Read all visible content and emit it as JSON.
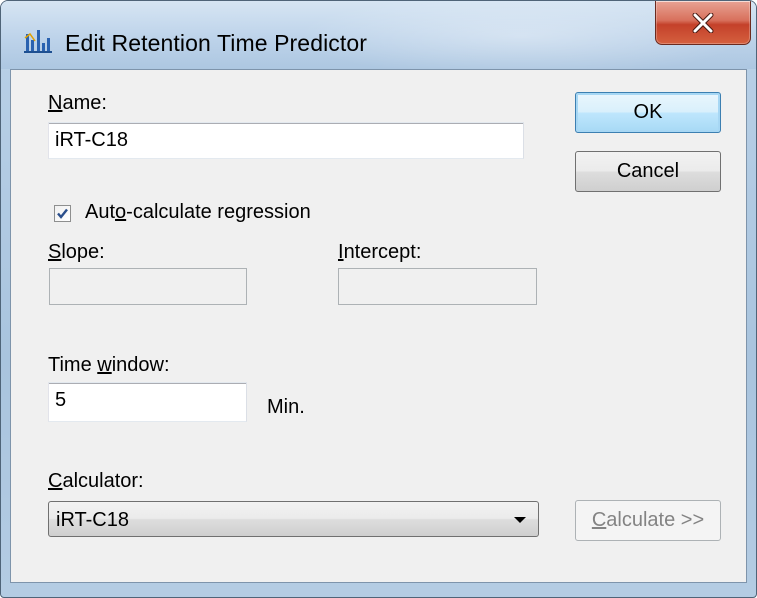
{
  "window": {
    "title": "Edit Retention Time Predictor",
    "close_glyph": "X"
  },
  "name": {
    "label_pre": "",
    "label_acc": "N",
    "label_post": "ame:",
    "value": "iRT-C18"
  },
  "auto_calc": {
    "checked": true,
    "label_pre": "Aut",
    "label_acc": "o",
    "label_post": "-calculate regression"
  },
  "slope": {
    "label_acc": "S",
    "label_post": "lope:",
    "value": ""
  },
  "intercept": {
    "label_acc": "I",
    "label_post": "ntercept:",
    "value": ""
  },
  "time_window": {
    "label_pre": "Time ",
    "label_acc": "w",
    "label_post": "indow:",
    "value": "5",
    "unit": "Min."
  },
  "calculator": {
    "label_acc": "C",
    "label_post": "alculator:",
    "selected": "iRT-C18"
  },
  "buttons": {
    "ok": "OK",
    "cancel": "Cancel",
    "calculate_acc": "C",
    "calculate_post": "alculate >>"
  },
  "icons": {
    "app": "chart-bars-icon",
    "close": "close-icon",
    "check": "checkmark-icon",
    "dropdown": "chevron-down-icon"
  }
}
